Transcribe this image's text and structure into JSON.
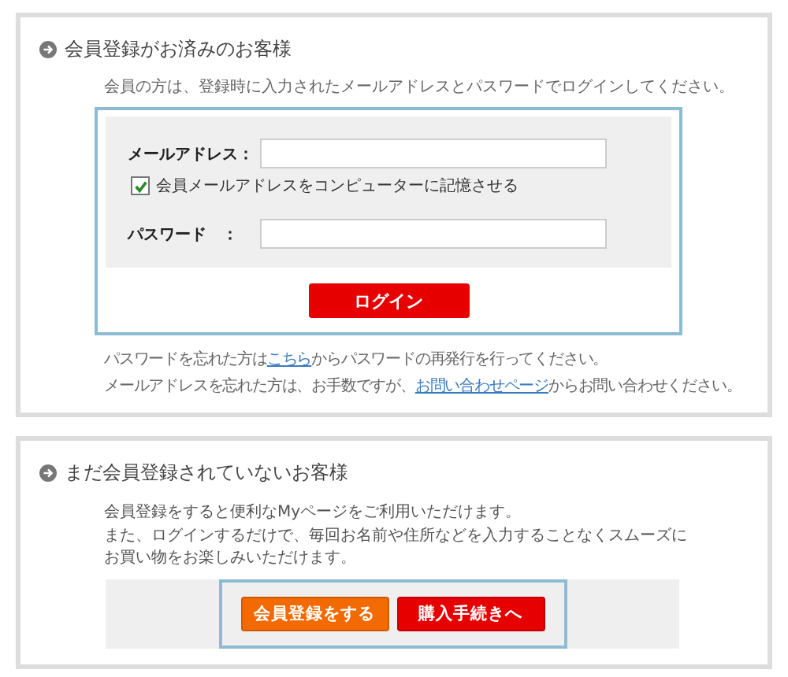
{
  "member_section": {
    "heading": "会員登録がお済みのお客様",
    "intro": "会員の方は、登録時に入力されたメールアドレスとパスワードでログインしてください。",
    "email": {
      "label": "メールアドレス："
    },
    "remember": {
      "label": "会員メールアドレスをコンピューターに記憶させる",
      "checked": true
    },
    "password": {
      "label": "パスワード　："
    },
    "login_button": "ログイン",
    "help": [
      {
        "before": "パスワードを忘れた方は",
        "link": "こちら",
        "after": "からパスワードの再発行を行ってください。"
      },
      {
        "before": "メールアドレスを忘れた方は、お手数ですが、",
        "link": "お問い合わせページ",
        "after": "からお問い合わせください。"
      }
    ]
  },
  "guest_section": {
    "heading": "まだ会員登録されていないお客様",
    "paragraphs": [
      "会員登録をすると便利なMyページをご利用いただけます。",
      "また、ログインするだけで、毎回お名前や住所などを入力することなくスムーズにお買い物をお楽しみいただけます。"
    ],
    "buttons": [
      {
        "label": "会員登録をする",
        "kind": "orange"
      },
      {
        "label": "購入手続きへ",
        "kind": "red"
      }
    ]
  }
}
